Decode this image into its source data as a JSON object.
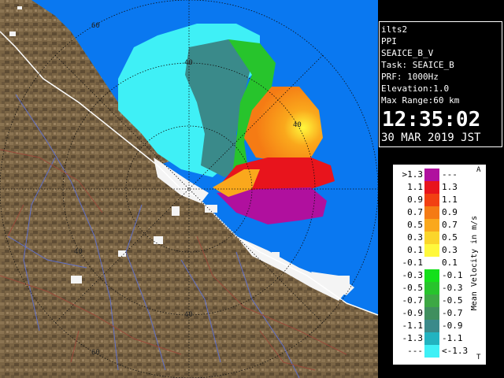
{
  "station": "ilts2",
  "product": "PPI",
  "field": "SEAICE_B_V",
  "task": "Task: SEAICE_B",
  "prf": "PRF: 1000Hz",
  "elevation": "Elevation:1.0",
  "max_range": "Max Range:60 km",
  "time": "12:35:02",
  "date": "30 MAR 2019 JST",
  "range_ring_labels": [
    "60",
    "40",
    "40",
    "40",
    "40",
    "60"
  ],
  "legend": {
    "unit": "Mean Velocity in m/s",
    "top_mark": "A",
    "bottom_mark": "T",
    "rows": [
      {
        "lo": ">1.3",
        "hi": "---",
        "color": "#b0109e"
      },
      {
        "lo": "1.1",
        "hi": "1.3",
        "color": "#e8141c"
      },
      {
        "lo": "0.9",
        "hi": "1.1",
        "color": "#f24012"
      },
      {
        "lo": "0.7",
        "hi": "0.9",
        "color": "#f57b14"
      },
      {
        "lo": "0.5",
        "hi": "0.7",
        "color": "#faa81c"
      },
      {
        "lo": "0.3",
        "hi": "0.5",
        "color": "#fbd52a"
      },
      {
        "lo": "0.1",
        "hi": "0.3",
        "color": "#fff83c"
      },
      {
        "lo": "-0.1",
        "hi": "0.1",
        "color": "#ffffff"
      },
      {
        "lo": "-0.3",
        "hi": "-0.1",
        "color": "#14e01a"
      },
      {
        "lo": "-0.5",
        "hi": "-0.3",
        "color": "#27c42c"
      },
      {
        "lo": "-0.7",
        "hi": "-0.5",
        "color": "#3da844"
      },
      {
        "lo": "-0.9",
        "hi": "-0.7",
        "color": "#3f8f5e"
      },
      {
        "lo": "-1.1",
        "hi": "-0.9",
        "color": "#3a8a8a"
      },
      {
        "lo": "-1.3",
        "hi": "-1.1",
        "color": "#22b3c0"
      },
      {
        "lo": "---",
        "hi": "<-1.3",
        "color": "#3ff0f6"
      }
    ]
  },
  "colors": {
    "sea": "#0a78f0",
    "land": "#7a6444",
    "snow": "#f4f4f4",
    "rivers": "#6070c8",
    "roads": "#9a4a3a",
    "rings": "#101010",
    "panel_bg": "#000000",
    "panel_text": "#ffffff"
  }
}
